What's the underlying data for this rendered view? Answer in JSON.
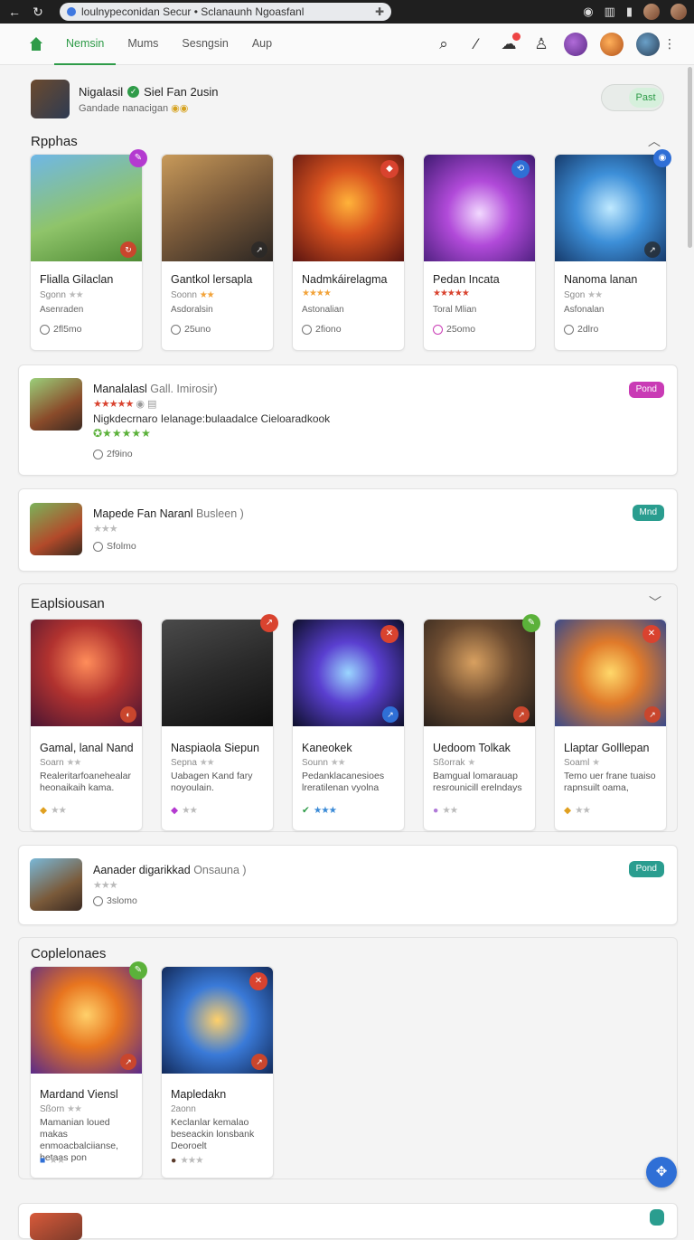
{
  "browser": {
    "url": "loulnypeconidan Secur • Sclanaunh Ngoasfanl"
  },
  "header": {
    "tabs": [
      "Nemsin",
      "Mums",
      "Sesngsin",
      "Aup"
    ]
  },
  "profile": {
    "name": "Nigalasil",
    "name_extra": "Siel  Fan 2usin",
    "subtitle": "Gandade nanacigan",
    "toggle_label": "Past"
  },
  "section1": {
    "title": "Rpphas",
    "cards": [
      {
        "title": "Flialla Gilaclan",
        "sub": "Sgonn",
        "line": "Asenraden",
        "meta": "2fl5mo",
        "stars": "★★"
      },
      {
        "title": "Gantkol lersapla",
        "sub": "Soonn",
        "line": "Asdoralsin",
        "meta": "25uno",
        "stars": "★★"
      },
      {
        "title": "Nadmkáirelagma",
        "sub": "",
        "line": "Astonalian",
        "meta": "2fiono",
        "stars": "★★★★"
      },
      {
        "title": "Pedan Incata",
        "sub": "",
        "line": "Toral Mlian",
        "meta": "25omo",
        "stars": "★★★★★"
      },
      {
        "title": "Nanoma lanan",
        "sub": "Sgon",
        "line": "Asfonalan",
        "meta": "2dlro",
        "stars": "★★"
      }
    ]
  },
  "wide1": {
    "title": "Manalalasl",
    "title_muted": "Gall. Imirosir)",
    "line": "Nigkdecrnaro  Ielanage:bulaadalce  Cieloaradkook",
    "meta": "2f9ino",
    "pill": "Pond"
  },
  "wide2": {
    "title": "Mapede Fan Naranl",
    "title_muted": "Busleen )",
    "meta": "Sfolmo",
    "pill": "Mnd"
  },
  "section2": {
    "title": "Eaplsiousan",
    "cards": [
      {
        "title": "Gamal, lanal Nand",
        "sub": "Soarn",
        "desc": "Realeritarfoanehealar heonaikaih kama."
      },
      {
        "title": "Naspiaola Siepun",
        "sub": "Sepna",
        "desc": "Uabagen Kand fary noyoulain."
      },
      {
        "title": "Kaneokek",
        "sub": "Sounn",
        "desc": "Pedanklacanesioes lreratilenan vyolna"
      },
      {
        "title": "Uedoom Tolkak",
        "sub": "Sßorrak",
        "desc": "Bamgual lomarauap resrounicill erelndays"
      },
      {
        "title": "Llaptar Golllepan",
        "sub": "Soaml",
        "desc": "Temo uer frane tuaiso rapnsuilt oama,"
      }
    ]
  },
  "wide3": {
    "title": "Aanader digarikkad",
    "title_muted": "Onsauna )",
    "meta": "3slomo",
    "pill": "Pond"
  },
  "section3": {
    "title": "Coplelonaes",
    "cards": [
      {
        "title": "Mardand Viensl",
        "sub": "Sßorn",
        "desc": "Mamanian loued makas enmoacbalciianse, betaas pon"
      },
      {
        "title": "Mapledakn",
        "sub": "2aonn",
        "desc": "Keclanlar kemalao beseackin lonsbank Deoroelt"
      }
    ]
  },
  "colors": {
    "accent": "#2e9b48",
    "pill_pink": "#c93bb5",
    "pill_teal": "#2a9d8f",
    "fab": "#2f6fd6"
  }
}
